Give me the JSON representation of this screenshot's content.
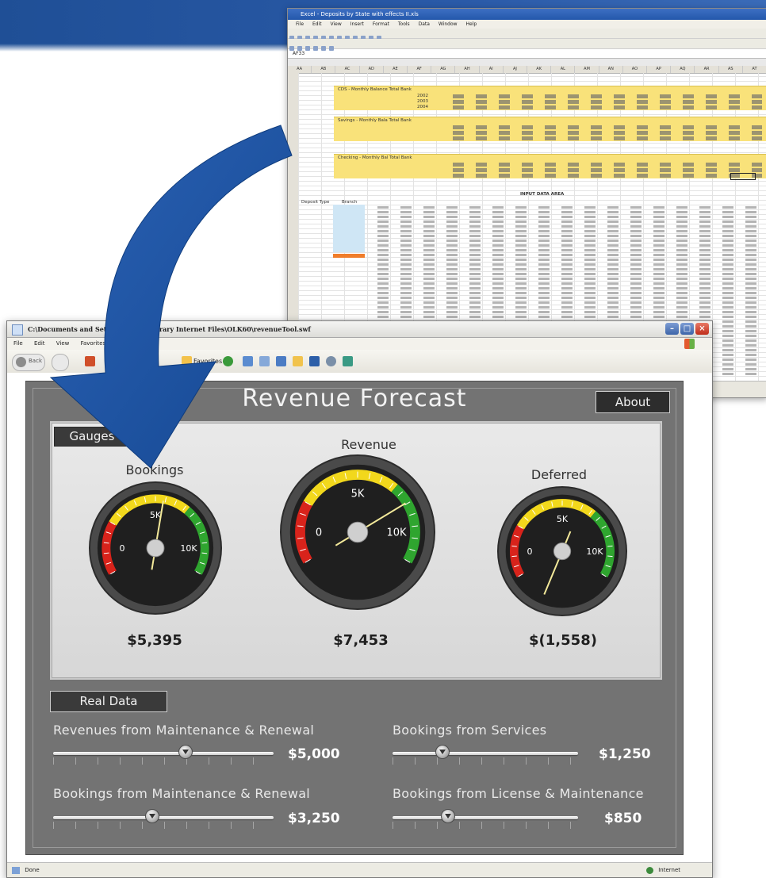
{
  "excel": {
    "title": "Excel - Deposits by State with effects II.xls",
    "menu": [
      "File",
      "Edit",
      "View",
      "Insert",
      "Format",
      "Tools",
      "Data",
      "Window",
      "Help"
    ],
    "name_box": "AF33",
    "section_labels": [
      "CDS - Monthly Balance Total Bank",
      "Savings - Monthly Bala Total Bank",
      "Checking - Monthly Bal Total Bank"
    ],
    "year_labels": [
      "2002",
      "2003",
      "2004"
    ],
    "input_area_title": "INPUT DATA AREA",
    "input_headers": [
      "Deposit Type",
      "Branch"
    ]
  },
  "browser": {
    "title": "C:\\Documents and Settings\\...\\Temporary Internet Files\\OLK60\\revenueTool.swf",
    "menu": [
      "File",
      "Edit",
      "View",
      "Favorites"
    ],
    "toolbar": {
      "back_label": "Back",
      "favorites_label": "Favorites"
    },
    "status": {
      "left": "Done",
      "right": "Internet"
    }
  },
  "app": {
    "title": "Revenue Forecast",
    "about_label": "About",
    "gauges_tab": "Gauges",
    "real_data_tab": "Real Data",
    "gauges": [
      {
        "label": "Bookings",
        "value_text": "$5,395",
        "value": 5395,
        "min_label": "0",
        "mid_label": "5K",
        "max_label": "10K"
      },
      {
        "label": "Revenue",
        "value_text": "$7,453",
        "value": 7453,
        "min_label": "0",
        "mid_label": "5K",
        "max_label": "10K"
      },
      {
        "label": "Deferred",
        "value_text": "$(1,558)",
        "value": -1558,
        "min_label": "0",
        "mid_label": "5K",
        "max_label": "10K"
      }
    ],
    "sliders": [
      {
        "label": "Revenues from Maintenance & Renewal",
        "value_text": "$5,000",
        "level": 0.6
      },
      {
        "label": "Bookings from Services",
        "value_text": "$1,250",
        "level": 0.27
      },
      {
        "label": "Bookings from Maintenance & Renewal",
        "value_text": "$3,250",
        "level": 0.45
      },
      {
        "label": "Bookings from License & Maintenance",
        "value_text": "$850",
        "level": 0.3
      }
    ]
  },
  "colors": {
    "banner": "#1f4f96",
    "arrow": "#1b4f9b",
    "app_bg": "#737373",
    "gauge_red": "#d8231b",
    "gauge_yellow": "#f2d81c",
    "gauge_green": "#2fa52f",
    "needle": "#f3e99a"
  }
}
